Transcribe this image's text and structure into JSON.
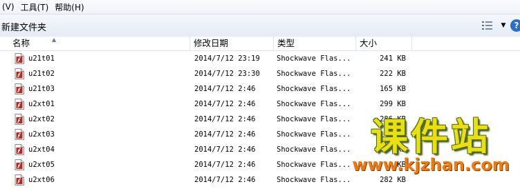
{
  "menubar": {
    "items": [
      "(V)",
      "工具(T)",
      "帮助(H)"
    ]
  },
  "toolbar": {
    "new_folder": "新建文件夹",
    "help": "?"
  },
  "columns": {
    "name": "名称",
    "date": "修改日期",
    "type": "类型",
    "size": "大小"
  },
  "files": [
    {
      "name": "u21t01",
      "date": "2014/7/12 23:19",
      "type": "Shockwave Flas...",
      "size": "241 KB"
    },
    {
      "name": "u21t02",
      "date": "2014/7/12 23:30",
      "type": "Shockwave Flas...",
      "size": "222 KB"
    },
    {
      "name": "u21t03",
      "date": "2014/7/12 2:46",
      "type": "Shockwave Flas...",
      "size": "165 KB"
    },
    {
      "name": "u2xt01",
      "date": "2014/7/12 2:46",
      "type": "Shockwave Flas...",
      "size": "299 KB"
    },
    {
      "name": "u2xt02",
      "date": "2014/7/12 2:46",
      "type": "Shockwave Flas...",
      "size": "286 KB"
    },
    {
      "name": "u2xt03",
      "date": "2014/7/12 2:46",
      "type": "Shockwave Flas...",
      "size": "KB"
    },
    {
      "name": "u2xt04",
      "date": "2014/7/12 2:46",
      "type": "Shockwave Flas...",
      "size": "KB"
    },
    {
      "name": "u2xt05",
      "date": "2014/7/12 2:46",
      "type": "Shockwave Flas...",
      "size": "KB"
    },
    {
      "name": "u2xt06",
      "date": "2014/7/12 2:46",
      "type": "Shockwave Flas...",
      "size": "282 KB"
    }
  ],
  "icons": {
    "file": "flash-file-icon",
    "view": "view-details-icon"
  },
  "colors": {
    "file_icon": "#c8201a",
    "watermark_text": "#ecdf10",
    "watermark_url": "#ee7a10"
  },
  "watermark": {
    "title": "课件站",
    "url": "www.kjzhan.com"
  }
}
